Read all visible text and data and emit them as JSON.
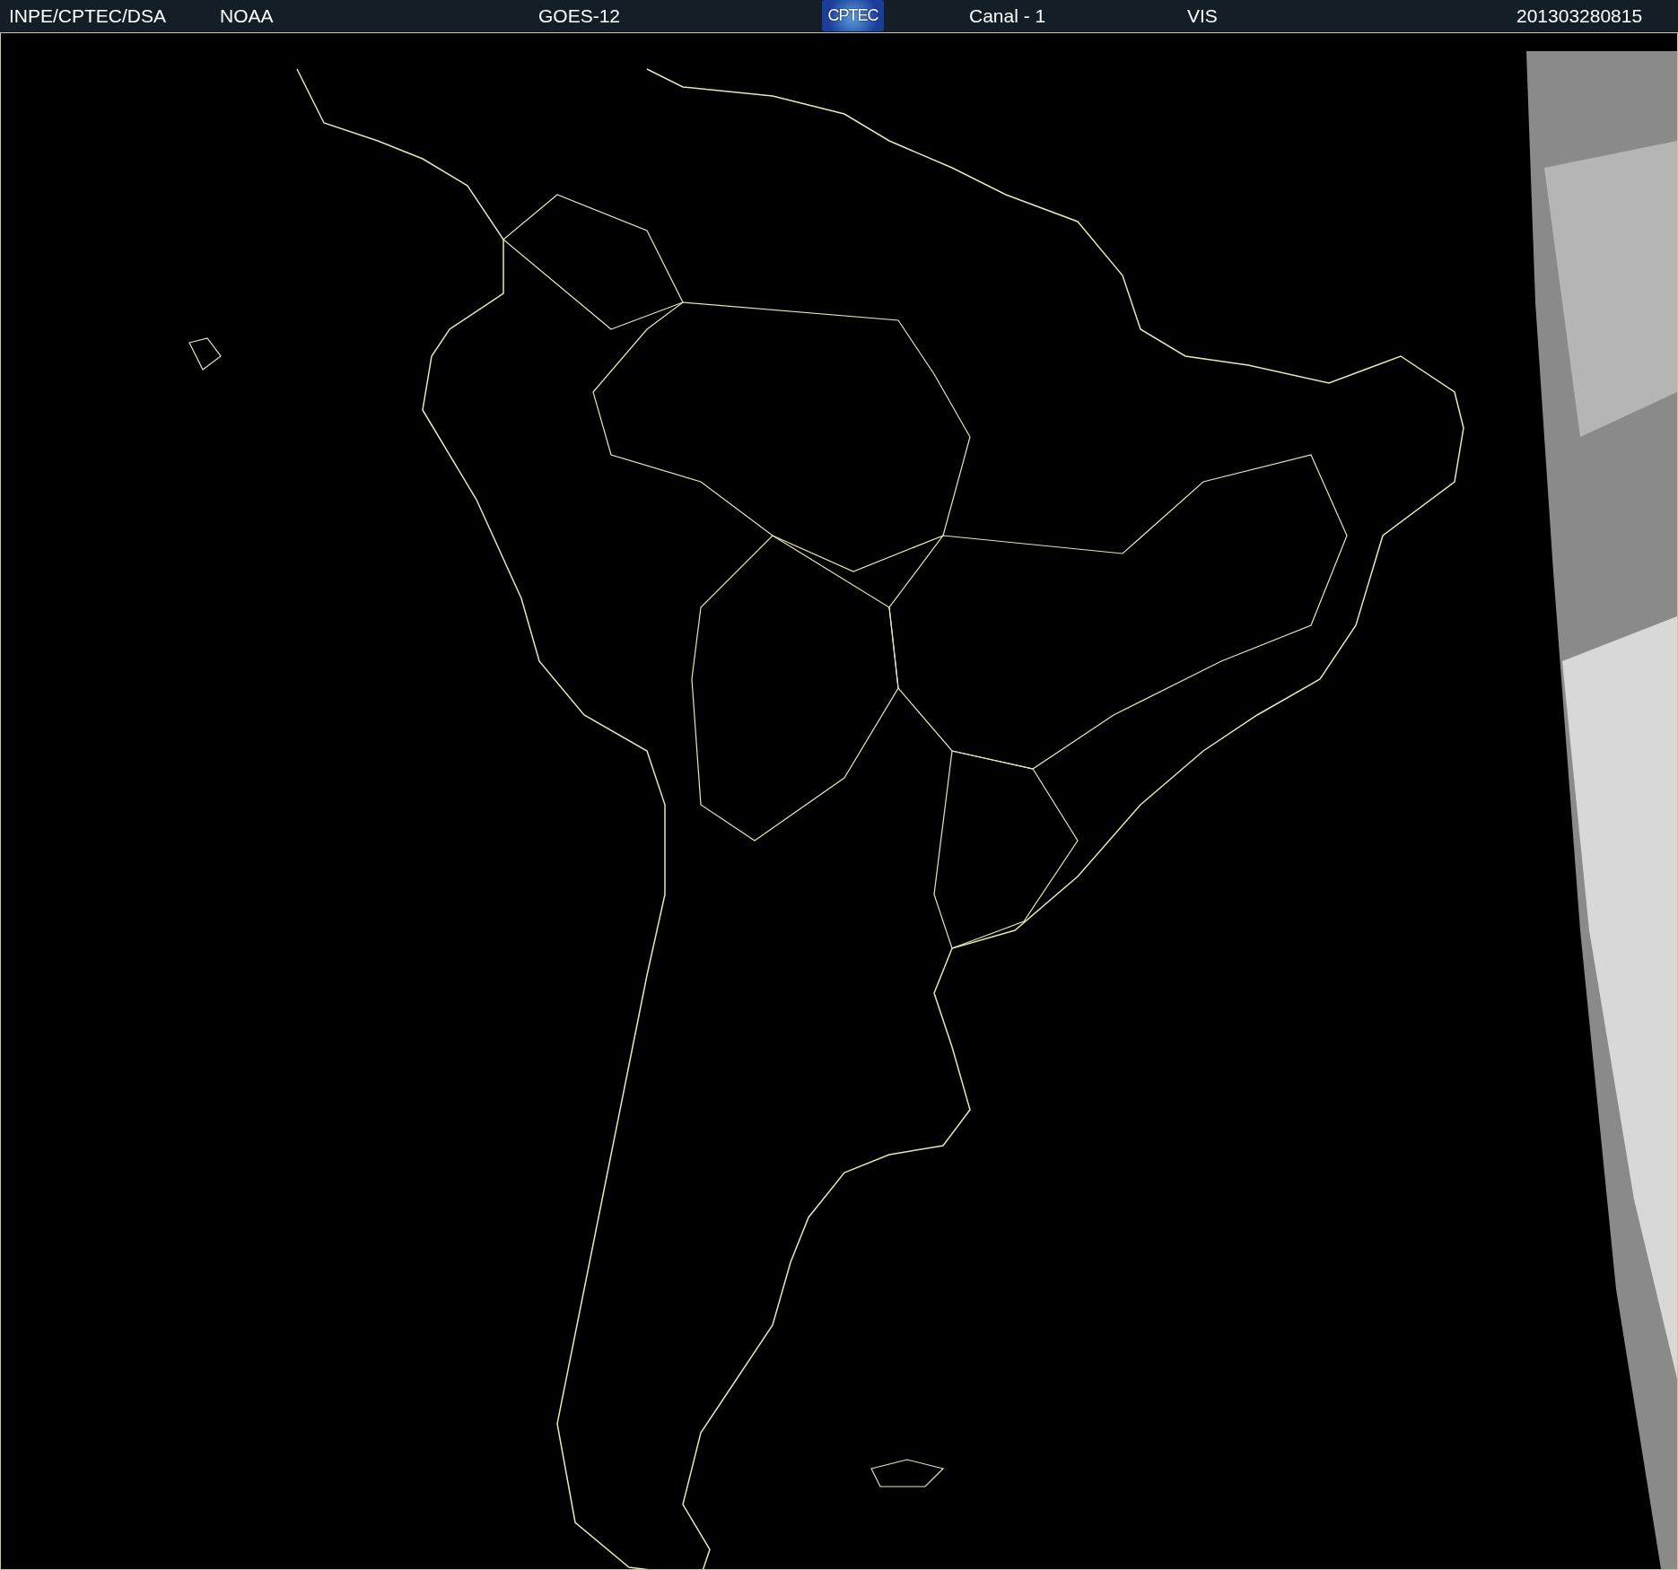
{
  "header": {
    "items": [
      {
        "kind": "text",
        "label": "INPE/CPTEC/DSA"
      },
      {
        "kind": "text",
        "label": "NOAA"
      },
      {
        "kind": "text",
        "label": "GOES-12"
      },
      {
        "kind": "logo",
        "label": "CPTEC"
      },
      {
        "kind": "text",
        "label": "Canal - 1"
      },
      {
        "kind": "text",
        "label": "VIS"
      },
      {
        "kind": "text",
        "label": "201303280815"
      }
    ]
  }
}
